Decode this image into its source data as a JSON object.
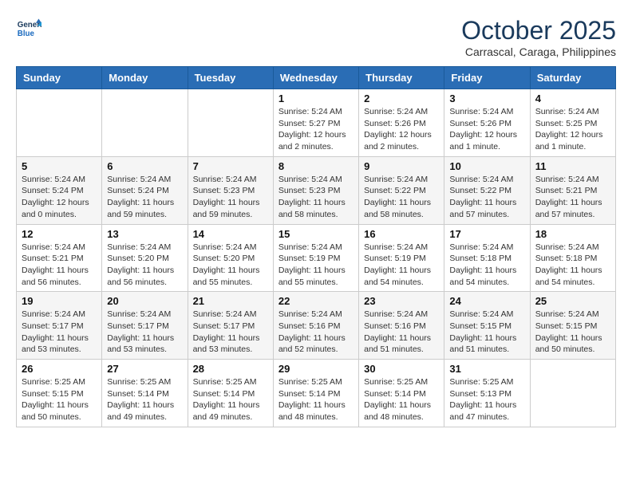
{
  "header": {
    "logo_line1": "General",
    "logo_line2": "Blue",
    "month": "October 2025",
    "location": "Carrascal, Caraga, Philippines"
  },
  "weekdays": [
    "Sunday",
    "Monday",
    "Tuesday",
    "Wednesday",
    "Thursday",
    "Friday",
    "Saturday"
  ],
  "weeks": [
    [
      {
        "day": "",
        "info": ""
      },
      {
        "day": "",
        "info": ""
      },
      {
        "day": "",
        "info": ""
      },
      {
        "day": "1",
        "info": "Sunrise: 5:24 AM\nSunset: 5:27 PM\nDaylight: 12 hours and 2 minutes."
      },
      {
        "day": "2",
        "info": "Sunrise: 5:24 AM\nSunset: 5:26 PM\nDaylight: 12 hours and 2 minutes."
      },
      {
        "day": "3",
        "info": "Sunrise: 5:24 AM\nSunset: 5:26 PM\nDaylight: 12 hours and 1 minute."
      },
      {
        "day": "4",
        "info": "Sunrise: 5:24 AM\nSunset: 5:25 PM\nDaylight: 12 hours and 1 minute."
      }
    ],
    [
      {
        "day": "5",
        "info": "Sunrise: 5:24 AM\nSunset: 5:24 PM\nDaylight: 12 hours and 0 minutes."
      },
      {
        "day": "6",
        "info": "Sunrise: 5:24 AM\nSunset: 5:24 PM\nDaylight: 11 hours and 59 minutes."
      },
      {
        "day": "7",
        "info": "Sunrise: 5:24 AM\nSunset: 5:23 PM\nDaylight: 11 hours and 59 minutes."
      },
      {
        "day": "8",
        "info": "Sunrise: 5:24 AM\nSunset: 5:23 PM\nDaylight: 11 hours and 58 minutes."
      },
      {
        "day": "9",
        "info": "Sunrise: 5:24 AM\nSunset: 5:22 PM\nDaylight: 11 hours and 58 minutes."
      },
      {
        "day": "10",
        "info": "Sunrise: 5:24 AM\nSunset: 5:22 PM\nDaylight: 11 hours and 57 minutes."
      },
      {
        "day": "11",
        "info": "Sunrise: 5:24 AM\nSunset: 5:21 PM\nDaylight: 11 hours and 57 minutes."
      }
    ],
    [
      {
        "day": "12",
        "info": "Sunrise: 5:24 AM\nSunset: 5:21 PM\nDaylight: 11 hours and 56 minutes."
      },
      {
        "day": "13",
        "info": "Sunrise: 5:24 AM\nSunset: 5:20 PM\nDaylight: 11 hours and 56 minutes."
      },
      {
        "day": "14",
        "info": "Sunrise: 5:24 AM\nSunset: 5:20 PM\nDaylight: 11 hours and 55 minutes."
      },
      {
        "day": "15",
        "info": "Sunrise: 5:24 AM\nSunset: 5:19 PM\nDaylight: 11 hours and 55 minutes."
      },
      {
        "day": "16",
        "info": "Sunrise: 5:24 AM\nSunset: 5:19 PM\nDaylight: 11 hours and 54 minutes."
      },
      {
        "day": "17",
        "info": "Sunrise: 5:24 AM\nSunset: 5:18 PM\nDaylight: 11 hours and 54 minutes."
      },
      {
        "day": "18",
        "info": "Sunrise: 5:24 AM\nSunset: 5:18 PM\nDaylight: 11 hours and 54 minutes."
      }
    ],
    [
      {
        "day": "19",
        "info": "Sunrise: 5:24 AM\nSunset: 5:17 PM\nDaylight: 11 hours and 53 minutes."
      },
      {
        "day": "20",
        "info": "Sunrise: 5:24 AM\nSunset: 5:17 PM\nDaylight: 11 hours and 53 minutes."
      },
      {
        "day": "21",
        "info": "Sunrise: 5:24 AM\nSunset: 5:17 PM\nDaylight: 11 hours and 53 minutes."
      },
      {
        "day": "22",
        "info": "Sunrise: 5:24 AM\nSunset: 5:16 PM\nDaylight: 11 hours and 52 minutes."
      },
      {
        "day": "23",
        "info": "Sunrise: 5:24 AM\nSunset: 5:16 PM\nDaylight: 11 hours and 51 minutes."
      },
      {
        "day": "24",
        "info": "Sunrise: 5:24 AM\nSunset: 5:15 PM\nDaylight: 11 hours and 51 minutes."
      },
      {
        "day": "25",
        "info": "Sunrise: 5:24 AM\nSunset: 5:15 PM\nDaylight: 11 hours and 50 minutes."
      }
    ],
    [
      {
        "day": "26",
        "info": "Sunrise: 5:25 AM\nSunset: 5:15 PM\nDaylight: 11 hours and 50 minutes."
      },
      {
        "day": "27",
        "info": "Sunrise: 5:25 AM\nSunset: 5:14 PM\nDaylight: 11 hours and 49 minutes."
      },
      {
        "day": "28",
        "info": "Sunrise: 5:25 AM\nSunset: 5:14 PM\nDaylight: 11 hours and 49 minutes."
      },
      {
        "day": "29",
        "info": "Sunrise: 5:25 AM\nSunset: 5:14 PM\nDaylight: 11 hours and 48 minutes."
      },
      {
        "day": "30",
        "info": "Sunrise: 5:25 AM\nSunset: 5:14 PM\nDaylight: 11 hours and 48 minutes."
      },
      {
        "day": "31",
        "info": "Sunrise: 5:25 AM\nSunset: 5:13 PM\nDaylight: 11 hours and 47 minutes."
      },
      {
        "day": "",
        "info": ""
      }
    ]
  ]
}
